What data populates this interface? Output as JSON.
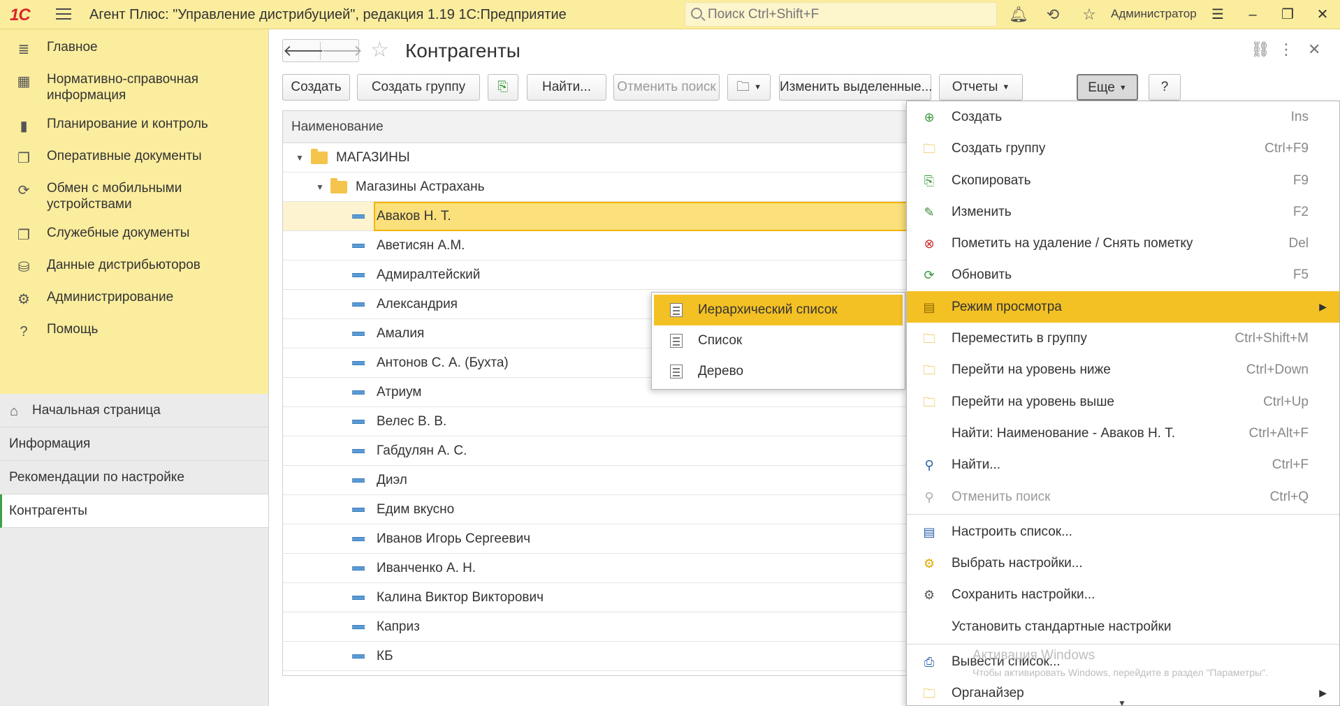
{
  "app": {
    "logo": "1С",
    "title": "Агент Плюс: \"Управление дистрибуцией\", редакция 1.19 1С:Предприятие",
    "search_placeholder": "Поиск Ctrl+Shift+F",
    "user": "Администратор",
    "icons": [
      "bell-icon",
      "history-icon",
      "star-icon",
      "settings-icon"
    ]
  },
  "sidebar": {
    "sections": [
      {
        "label": "Главное",
        "icon": "≣"
      },
      {
        "label": "Нормативно-справочная информация",
        "icon": "▦"
      },
      {
        "label": "Планирование и контроль",
        "icon": "▮"
      },
      {
        "label": "Оперативные документы",
        "icon": "❐"
      },
      {
        "label": "Обмен с мобильными устройствами",
        "icon": "⟳"
      },
      {
        "label": "Служебные документы",
        "icon": "❐"
      },
      {
        "label": "Данные дистрибьюторов",
        "icon": "⛁"
      },
      {
        "label": "Администрирование",
        "icon": "⚙"
      },
      {
        "label": "Помощь",
        "icon": "?"
      }
    ],
    "open_windows": [
      {
        "label": "Начальная страница"
      },
      {
        "label": "Информация"
      },
      {
        "label": "Рекомендации по настройке"
      },
      {
        "label": "Контрагенты"
      }
    ]
  },
  "form": {
    "title": "Контрагенты",
    "buttons": {
      "create": "Создать",
      "create_group": "Создать группу",
      "find": "Найти...",
      "cancel_search": "Отменить поиск",
      "edit_selected": "Изменить выделенные...",
      "reports": "Отчеты",
      "more": "Еще",
      "help": "?"
    }
  },
  "table": {
    "header": "Наименование",
    "groups": [
      {
        "label": "МАГАЗИНЫ"
      },
      {
        "label": "Магазины Астрахань"
      }
    ],
    "rows": [
      "Аваков Н. Т.",
      "Аветисян А.М.",
      "Адмиралтейский",
      "Александрия",
      "Амалия",
      "Антонов С. А. (Бухта)",
      "Атриум",
      "Велес В. В.",
      "Габдулян А. С.",
      "Диэл",
      "Едим вкусно",
      "Иванов Игорь Сергеевич",
      "Иванченко А. Н.",
      "Калина Виктор Викторович",
      "Каприз",
      "КБ"
    ]
  },
  "menu": {
    "items": [
      {
        "label": "Создать",
        "shortcut": "Ins"
      },
      {
        "label": "Создать группу",
        "shortcut": "Ctrl+F9"
      },
      {
        "label": "Скопировать",
        "shortcut": "F9"
      },
      {
        "label": "Изменить",
        "shortcut": "F2"
      },
      {
        "label": "Пометить на удаление / Снять пометку",
        "shortcut": "Del"
      },
      {
        "label": "Обновить",
        "shortcut": "F5"
      },
      {
        "label": "Режим просмотра",
        "shortcut": ""
      },
      {
        "label": "Переместить в группу",
        "shortcut": "Ctrl+Shift+M"
      },
      {
        "label": "Перейти на уровень ниже",
        "shortcut": "Ctrl+Down"
      },
      {
        "label": "Перейти на уровень выше",
        "shortcut": "Ctrl+Up"
      },
      {
        "label": "Найти: Наименование - Аваков Н. Т.",
        "shortcut": "Ctrl+Alt+F"
      },
      {
        "label": "Найти...",
        "shortcut": "Ctrl+F"
      },
      {
        "label": "Отменить поиск",
        "shortcut": "Ctrl+Q"
      },
      {
        "label": "Настроить список...",
        "shortcut": ""
      },
      {
        "label": "Выбрать настройки...",
        "shortcut": ""
      },
      {
        "label": "Сохранить настройки...",
        "shortcut": ""
      },
      {
        "label": "Установить стандартные настройки",
        "shortcut": ""
      },
      {
        "label": "Вывести список...",
        "shortcut": ""
      },
      {
        "label": "Органайзер",
        "shortcut": ""
      }
    ]
  },
  "submenu": {
    "items": [
      {
        "label": "Иерархический список"
      },
      {
        "label": "Список"
      },
      {
        "label": "Дерево"
      }
    ]
  },
  "watermark": {
    "line1": "Активация Windows",
    "line2": "Чтобы активировать Windows, перейдите в раздел \"Параметры\"."
  },
  "colors": {
    "header_yellow": "#fbed9e",
    "highlight": "#f4c124",
    "active_green": "#3fa04a"
  }
}
